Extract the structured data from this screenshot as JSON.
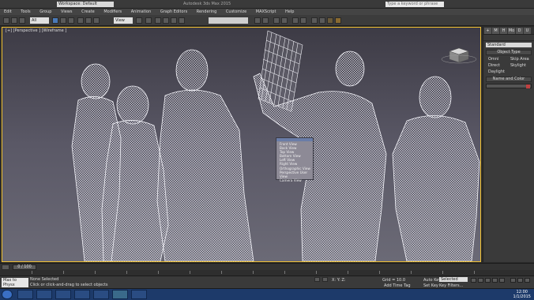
{
  "titlebar": {
    "workspace": "Workspace: Default",
    "title": "Autodesk 3ds Max 2015",
    "search_placeholder": "Type a keyword or phrase"
  },
  "menu": [
    "Edit",
    "Tools",
    "Group",
    "Views",
    "Create",
    "Modifiers",
    "Animation",
    "Graph Editors",
    "Rendering",
    "Customize",
    "MAXScript",
    "Help"
  ],
  "toolbar": {
    "filter_value": "All",
    "refcoord_value": "View",
    "selection_set": ""
  },
  "viewport": {
    "label": "[+] [Perspective ] [Wireframe ]",
    "context_menu": [
      "Front View",
      "Back View",
      "Top View",
      "Bottom View",
      "Left View",
      "Right View",
      "Orthographic View",
      "Perspective User View",
      "Camera View"
    ]
  },
  "command_panel": {
    "tabs": [
      "+",
      "M",
      "H",
      "Mo",
      "D",
      "U"
    ],
    "dropdown": "Standard",
    "object_type_title": "Object Type",
    "buttons": [
      "Omni",
      "Skip Area",
      "Direct",
      "Skylight",
      "Daylight",
      ""
    ],
    "name_color_title": "Name and Color"
  },
  "timeline": {
    "slider": "0 / 100"
  },
  "status": {
    "maxscript": "Max to Physx",
    "line1": "None Selected",
    "line2": "Click or click-and-drag to select objects",
    "xyz": "X:   Y:   Z:",
    "grid": "Grid = 10.0",
    "add_time_tag": "Add Time Tag",
    "autokey": "Auto Key",
    "set_key": "Set Key",
    "selected": "Selected",
    "key_filters": "Key Filters..."
  },
  "taskbar": {
    "time": "12:00",
    "date": "1/1/2015"
  }
}
